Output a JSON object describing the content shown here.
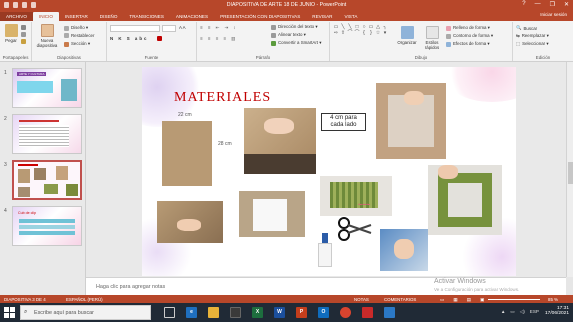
{
  "window": {
    "title": "DIAPOSITIVA DE ARTE 18 DE JUNIO  -  PowerPoint",
    "controls": [
      "—",
      "❐",
      "✕"
    ]
  },
  "ribbon_tabs": [
    "ARCHIVO",
    "INICIO",
    "INSERTAR",
    "DISEÑO",
    "TRANSICIONES",
    "ANIMACIONES",
    "PRESENTACIÓN CON DIAPOSITIVAS",
    "REVISAR",
    "VISTA"
  ],
  "signin": "Iniciar sesión",
  "ribbon": {
    "paste": "Pegar",
    "new_slide": "Nueva diapositiva",
    "design": "Diseño ▾",
    "reset": "Restablecer",
    "section": "Sección ▾",
    "text_direction": "Dirección del texto ▾",
    "align_text": "Alinear texto ▾",
    "smartart": "Convertir a SmartArt ▾",
    "arrange": "Organizar",
    "quick_styles": "Estilos rápidos",
    "shape_fill": "Relleno de forma ▾",
    "shape_outline": "Contorno de forma ▾",
    "shape_effects": "Efectos de forma ▾",
    "find": "Buscar",
    "replace": "Reemplazar ▾",
    "select": "Seleccionar ▾",
    "groups": {
      "clipboard": "Portapapeles",
      "slides": "Diapositivas",
      "font": "Fuente",
      "paragraph": "Párrafo",
      "drawing": "Dibujo",
      "editing": "Edición"
    }
  },
  "slides_pane": {
    "numbers": [
      "1",
      "2",
      "3",
      "4"
    ],
    "thumb1_title": "ARTE Y CULTURA",
    "thumb4_title": "Cub de clip"
  },
  "slide": {
    "title": "MATERIALES",
    "label_22cm": "22 cm",
    "label_28cm": "28 cm",
    "note_line1": "4 cm para",
    "note_line2": "cada lado"
  },
  "notes_placeholder": "Haga clic para agregar notas",
  "activation": {
    "line1": "Activar Windows",
    "line2": "Ve a Configuración para activar Windows."
  },
  "status": {
    "slide_counter": "DIAPOSITIVA 3 DE 4",
    "language": "ESPAÑOL (PERÚ)",
    "notes": "NOTAS",
    "comments": "COMENTARIOS",
    "zoom": "85 %"
  },
  "taskbar": {
    "search_placeholder": "Escribe aquí para buscar",
    "language": "ESP",
    "time": "17:31",
    "date": "17/06/2021"
  },
  "colors": {
    "accent": "#b7472a",
    "title_red": "#c00000"
  }
}
